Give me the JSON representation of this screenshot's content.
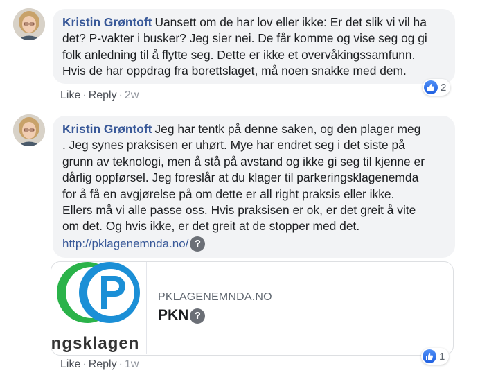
{
  "comments": [
    {
      "author": "Kristin Grøntoft",
      "text": "Uansett om de har lov eller ikke: Er det slik vi vil ha\ndet? P-vakter i busker? Jeg sier nei. De får komme og vise seg og gi\nfolk anledning til å flytte seg. Dette er ikke et overvåkingssamfunn.\nHvis de har oppdrag fra borettslaget, må noen snakke med dem.",
      "like_label": "Like",
      "reply_label": "Reply",
      "time": "2w",
      "reaction_count": "2"
    },
    {
      "author": "Kristin Grøntoft",
      "text": "Jeg har tentk på denne saken, og den plager meg\n. Jeg synes praksisen er uhørt. Mye har endret seg i det siste på\ngrunn av teknologi, men å stå på avstand og ikke gi seg til kjenne er\ndårlig oppførsel. Jeg foreslår at du klager til parkeringsklagenemda\nfor å få en avgjørelse på om dette er all right praksis eller ikke.\nEllers må vi alle passe oss. Hvis praksisen er ok, er det greit å vite\nom det. Og hvis ikke, er det greit at de stopper med det.",
      "link": "http://pklagenemnda.no/",
      "link_help": "?",
      "preview": {
        "domain": "PKLAGENEMNDA.NO",
        "title": "PKN",
        "title_help": "?",
        "logo_letter": "P",
        "logo_text": "ingsklagen"
      },
      "like_label": "Like",
      "reply_label": "Reply",
      "time": "1w",
      "reaction_count": "1"
    }
  ],
  "colors": {
    "author": "#385898",
    "bubble": "#f2f3f5",
    "like_blue": "#1f5fe0",
    "logo_blue": "#1b8fd6",
    "logo_green": "#2bb34a"
  }
}
